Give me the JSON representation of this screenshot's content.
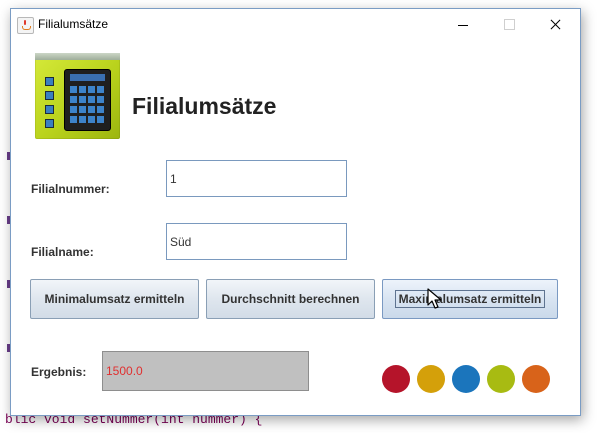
{
  "window": {
    "title": "Filialumsätze"
  },
  "header": {
    "app_title": "Filialumsätze"
  },
  "form": {
    "filialnummer": {
      "label": "Filialnummer:",
      "value": "1"
    },
    "filialname": {
      "label": "Filialname:",
      "value": "Süd"
    }
  },
  "buttons": {
    "min": "Minimalumsatz ermitteln",
    "avg": "Durchschnitt berechnen",
    "max": "Maximalumsatz ermitteln"
  },
  "result": {
    "label": "Ergebnis:",
    "value": "1500.0",
    "value_color": "#e03030"
  },
  "color_dots": [
    "#b5142a",
    "#d4a00a",
    "#1b75bc",
    "#a8bb12",
    "#d8631a"
  ],
  "background_code": {
    "bottom_line": "blic void setNummer(int nummer) {"
  }
}
